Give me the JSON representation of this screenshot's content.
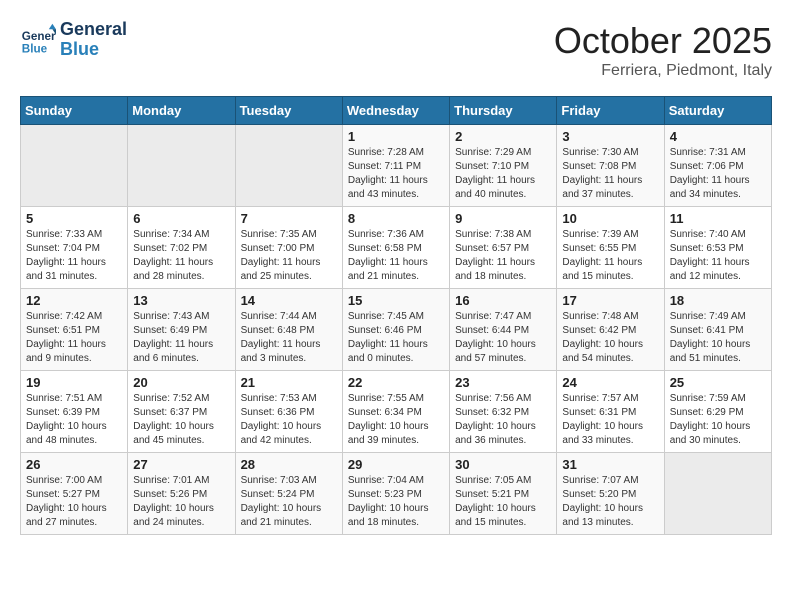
{
  "header": {
    "logo_line1": "General",
    "logo_line2": "Blue",
    "month": "October 2025",
    "location": "Ferriera, Piedmont, Italy"
  },
  "weekdays": [
    "Sunday",
    "Monday",
    "Tuesday",
    "Wednesday",
    "Thursday",
    "Friday",
    "Saturday"
  ],
  "weeks": [
    [
      {
        "day": "",
        "info": ""
      },
      {
        "day": "",
        "info": ""
      },
      {
        "day": "",
        "info": ""
      },
      {
        "day": "1",
        "info": "Sunrise: 7:28 AM\nSunset: 7:11 PM\nDaylight: 11 hours and 43 minutes."
      },
      {
        "day": "2",
        "info": "Sunrise: 7:29 AM\nSunset: 7:10 PM\nDaylight: 11 hours and 40 minutes."
      },
      {
        "day": "3",
        "info": "Sunrise: 7:30 AM\nSunset: 7:08 PM\nDaylight: 11 hours and 37 minutes."
      },
      {
        "day": "4",
        "info": "Sunrise: 7:31 AM\nSunset: 7:06 PM\nDaylight: 11 hours and 34 minutes."
      }
    ],
    [
      {
        "day": "5",
        "info": "Sunrise: 7:33 AM\nSunset: 7:04 PM\nDaylight: 11 hours and 31 minutes."
      },
      {
        "day": "6",
        "info": "Sunrise: 7:34 AM\nSunset: 7:02 PM\nDaylight: 11 hours and 28 minutes."
      },
      {
        "day": "7",
        "info": "Sunrise: 7:35 AM\nSunset: 7:00 PM\nDaylight: 11 hours and 25 minutes."
      },
      {
        "day": "8",
        "info": "Sunrise: 7:36 AM\nSunset: 6:58 PM\nDaylight: 11 hours and 21 minutes."
      },
      {
        "day": "9",
        "info": "Sunrise: 7:38 AM\nSunset: 6:57 PM\nDaylight: 11 hours and 18 minutes."
      },
      {
        "day": "10",
        "info": "Sunrise: 7:39 AM\nSunset: 6:55 PM\nDaylight: 11 hours and 15 minutes."
      },
      {
        "day": "11",
        "info": "Sunrise: 7:40 AM\nSunset: 6:53 PM\nDaylight: 11 hours and 12 minutes."
      }
    ],
    [
      {
        "day": "12",
        "info": "Sunrise: 7:42 AM\nSunset: 6:51 PM\nDaylight: 11 hours and 9 minutes."
      },
      {
        "day": "13",
        "info": "Sunrise: 7:43 AM\nSunset: 6:49 PM\nDaylight: 11 hours and 6 minutes."
      },
      {
        "day": "14",
        "info": "Sunrise: 7:44 AM\nSunset: 6:48 PM\nDaylight: 11 hours and 3 minutes."
      },
      {
        "day": "15",
        "info": "Sunrise: 7:45 AM\nSunset: 6:46 PM\nDaylight: 11 hours and 0 minutes."
      },
      {
        "day": "16",
        "info": "Sunrise: 7:47 AM\nSunset: 6:44 PM\nDaylight: 10 hours and 57 minutes."
      },
      {
        "day": "17",
        "info": "Sunrise: 7:48 AM\nSunset: 6:42 PM\nDaylight: 10 hours and 54 minutes."
      },
      {
        "day": "18",
        "info": "Sunrise: 7:49 AM\nSunset: 6:41 PM\nDaylight: 10 hours and 51 minutes."
      }
    ],
    [
      {
        "day": "19",
        "info": "Sunrise: 7:51 AM\nSunset: 6:39 PM\nDaylight: 10 hours and 48 minutes."
      },
      {
        "day": "20",
        "info": "Sunrise: 7:52 AM\nSunset: 6:37 PM\nDaylight: 10 hours and 45 minutes."
      },
      {
        "day": "21",
        "info": "Sunrise: 7:53 AM\nSunset: 6:36 PM\nDaylight: 10 hours and 42 minutes."
      },
      {
        "day": "22",
        "info": "Sunrise: 7:55 AM\nSunset: 6:34 PM\nDaylight: 10 hours and 39 minutes."
      },
      {
        "day": "23",
        "info": "Sunrise: 7:56 AM\nSunset: 6:32 PM\nDaylight: 10 hours and 36 minutes."
      },
      {
        "day": "24",
        "info": "Sunrise: 7:57 AM\nSunset: 6:31 PM\nDaylight: 10 hours and 33 minutes."
      },
      {
        "day": "25",
        "info": "Sunrise: 7:59 AM\nSunset: 6:29 PM\nDaylight: 10 hours and 30 minutes."
      }
    ],
    [
      {
        "day": "26",
        "info": "Sunrise: 7:00 AM\nSunset: 5:27 PM\nDaylight: 10 hours and 27 minutes."
      },
      {
        "day": "27",
        "info": "Sunrise: 7:01 AM\nSunset: 5:26 PM\nDaylight: 10 hours and 24 minutes."
      },
      {
        "day": "28",
        "info": "Sunrise: 7:03 AM\nSunset: 5:24 PM\nDaylight: 10 hours and 21 minutes."
      },
      {
        "day": "29",
        "info": "Sunrise: 7:04 AM\nSunset: 5:23 PM\nDaylight: 10 hours and 18 minutes."
      },
      {
        "day": "30",
        "info": "Sunrise: 7:05 AM\nSunset: 5:21 PM\nDaylight: 10 hours and 15 minutes."
      },
      {
        "day": "31",
        "info": "Sunrise: 7:07 AM\nSunset: 5:20 PM\nDaylight: 10 hours and 13 minutes."
      },
      {
        "day": "",
        "info": ""
      }
    ]
  ]
}
